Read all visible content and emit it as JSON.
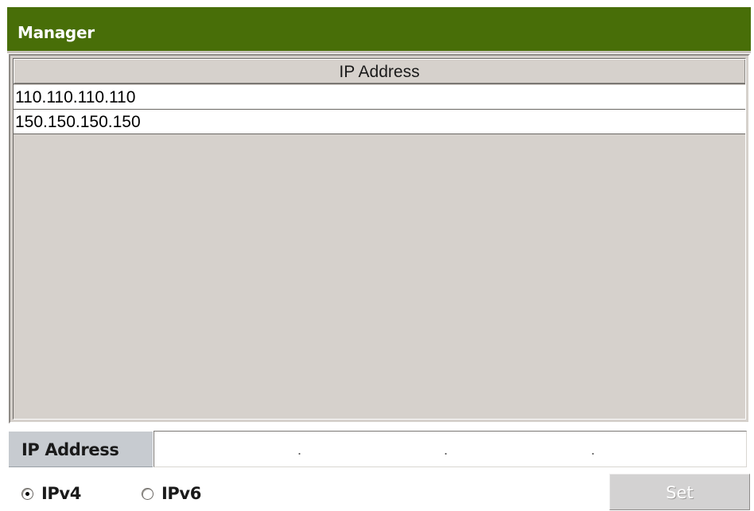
{
  "window": {
    "title": "Manager"
  },
  "table": {
    "column_header": "IP Address",
    "rows": [
      {
        "ip": "110.110.110.110"
      },
      {
        "ip": "150.150.150.150"
      }
    ]
  },
  "ip_input": {
    "label": "IP Address",
    "octets": [
      "",
      "",
      "",
      ""
    ],
    "separators": [
      ".",
      ".",
      "."
    ]
  },
  "ip_version": {
    "options": [
      {
        "label": "IPv4",
        "checked": true
      },
      {
        "label": "IPv6",
        "checked": false
      }
    ]
  },
  "actions": {
    "set_label": "Set",
    "set_disabled": true
  },
  "colors": {
    "titlebar": "#486e08",
    "panel_background": "#d6d1cc",
    "label_background": "#c7cbd0",
    "disabled_button": "#d3d2d2"
  }
}
